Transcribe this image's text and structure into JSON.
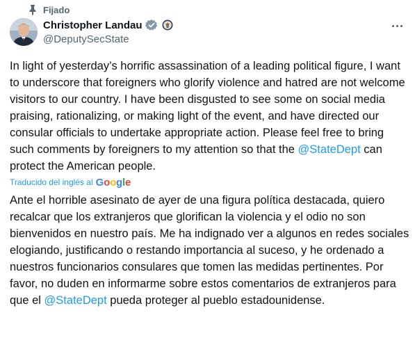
{
  "pinned": {
    "label": "Fijado",
    "icon": "pin-icon"
  },
  "author": {
    "name": "Christopher Landau",
    "handle": "@DeputySecState",
    "verified_icon": "verified-badge-icon",
    "affiliation_icon": "government-seal-icon"
  },
  "post": {
    "text_parts": [
      "In light of yesterday’s horrific assassination of a leading political figure, I want to underscore that foreigners who glorify violence and hatred are not welcome visitors to our country. I have been disgusted to see some on social media praising, rationalizing, or making light of the event, and have directed our consular officials to undertake appropriate action. Please feel free to bring such comments by foreigners to my attention so that the ",
      "@StateDept",
      " can protect the American people."
    ]
  },
  "translation": {
    "label": "Traducido del inglés al",
    "provider": "Google",
    "text_parts": [
      "Ante el horrible asesinato de ayer de una figura política destacada, quiero recalcar que los extranjeros que glorifican la violencia y el odio no son bienvenidos en nuestro país. Me ha indignado ver a algunos en redes sociales elogiando, justificando o restando importancia al suceso, y he ordenado a nuestros funcionarios consulares que tomen las medidas pertinentes. Por favor, no duden en informarme sobre estos comentarios de extranjeros para que el ",
      "@StateDept",
      " pueda proteger al pueblo estadounidense."
    ]
  },
  "colors": {
    "link": "#1d9bf0",
    "secondary_text": "#536471",
    "primary_text": "#0f1419",
    "verified": "#829aab"
  }
}
